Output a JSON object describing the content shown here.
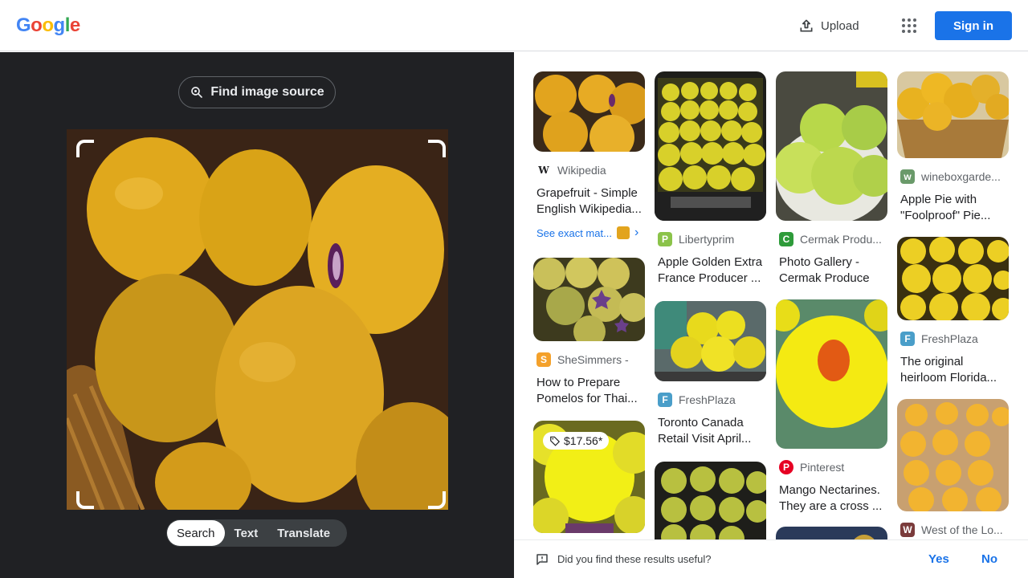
{
  "header": {
    "logo_letters": [
      "G",
      "o",
      "o",
      "g",
      "l",
      "e"
    ],
    "logo_colors": [
      "#4285F4",
      "#EA4335",
      "#FBBC05",
      "#4285F4",
      "#34A853",
      "#EA4335"
    ],
    "upload_label": "Upload",
    "signin_label": "Sign in"
  },
  "left": {
    "find_source_label": "Find image source",
    "modes": [
      "Search",
      "Text",
      "Translate"
    ],
    "active_mode": "Search"
  },
  "results": {
    "col1": [
      {
        "source": "Wikipedia",
        "title": "Grapefruit - Simple English Wikipedia...",
        "exact": "See exact mat...",
        "favicon": "W",
        "favicon_color": "#ffffff"
      },
      {
        "source": "SheSimmers -",
        "title": "How to Prepare Pomelos for Thai...",
        "favicon": "S",
        "favicon_color": "#f4a12b"
      },
      {
        "price": "$17.56*"
      }
    ],
    "col2": [
      {
        "source": "Libertyprim",
        "title": "Apple Golden Extra France Producer ...",
        "favicon": "P",
        "favicon_color": "#8bc34a"
      },
      {
        "source": "FreshPlaza",
        "title": "Toronto Canada Retail Visit April...",
        "favicon": "F",
        "favicon_color": "#4a9ec9"
      },
      {}
    ],
    "col3": [
      {
        "source": "Cermak Produ...",
        "title": "Photo Gallery - Cermak Produce",
        "favicon": "C",
        "favicon_color": "#2e9b3a"
      },
      {
        "source": "Pinterest",
        "title": "Mango Nectarines. They are a cross ...",
        "favicon": "P",
        "favicon_color": "#e60023"
      },
      {}
    ],
    "col4": [
      {
        "source": "wineboxgarde...",
        "title": "Apple Pie with \"Foolproof\" Pie...",
        "favicon": "w",
        "favicon_color": "#6a9a6a"
      },
      {
        "source": "FreshPlaza",
        "title": "The original heirloom Florida...",
        "favicon": "F",
        "favicon_color": "#4a9ec9"
      },
      {
        "source": "West of the Lo...",
        "favicon": "W",
        "favicon_color": "#7a3b3b"
      }
    ]
  },
  "feedback": {
    "question": "Did you find these results useful?",
    "yes": "Yes",
    "no": "No"
  }
}
